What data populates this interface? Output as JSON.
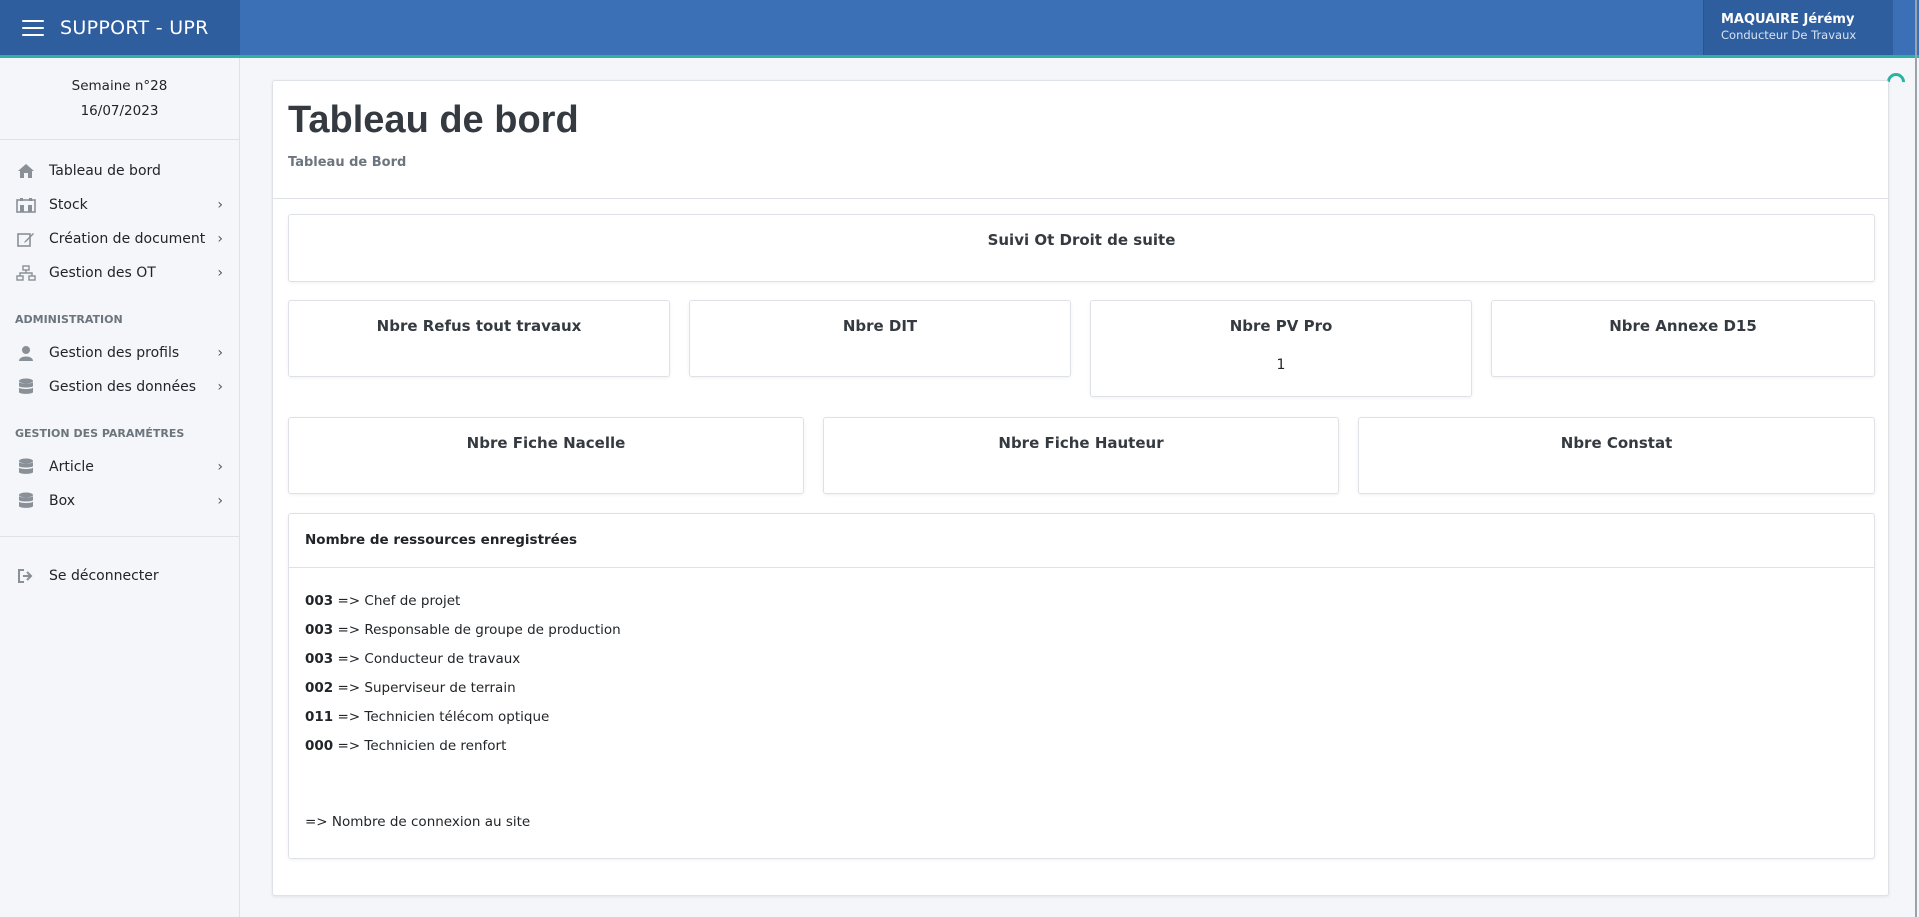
{
  "app": {
    "title": "SUPPORT - UPR"
  },
  "user": {
    "name": "MAQUAIRE Jérémy",
    "role": "Conducteur De Travaux"
  },
  "sidebar": {
    "week_label": "Semaine n°28",
    "date": "16/07/2023",
    "items": [
      {
        "label": "Tableau de bord",
        "icon": "home-icon",
        "has_children": false
      },
      {
        "label": "Stock",
        "icon": "warehouse-icon",
        "has_children": true
      },
      {
        "label": "Création de document",
        "icon": "edit-icon",
        "has_children": true
      },
      {
        "label": "Gestion des OT",
        "icon": "sitemap-icon",
        "has_children": true
      }
    ],
    "admin_title": "ADMINISTRATION",
    "admin_items": [
      {
        "label": "Gestion des profils",
        "icon": "user-icon"
      },
      {
        "label": "Gestion des données",
        "icon": "database-icon"
      }
    ],
    "params_title": "GESTION DES PARAMÉTRES",
    "params_items": [
      {
        "label": "Article",
        "icon": "database-icon"
      },
      {
        "label": "Box",
        "icon": "database-icon"
      }
    ],
    "logout_label": "Se déconnecter"
  },
  "page": {
    "title": "Tableau de bord",
    "breadcrumb": "Tableau de Bord",
    "banner": "Suivi Ot Droit de suite",
    "stats_row1": [
      {
        "title": "Nbre Refus tout travaux",
        "value": ""
      },
      {
        "title": "Nbre DIT",
        "value": ""
      },
      {
        "title": "Nbre PV Pro",
        "value": "1"
      },
      {
        "title": "Nbre Annexe D15",
        "value": ""
      }
    ],
    "stats_row2": [
      {
        "title": "Nbre Fiche Nacelle",
        "value": ""
      },
      {
        "title": "Nbre Fiche Hauteur",
        "value": ""
      },
      {
        "title": "Nbre Constat",
        "value": ""
      }
    ],
    "resources": {
      "title": "Nombre de ressources enregistrées",
      "rows": [
        {
          "count": "003",
          "text": " => Chef de projet"
        },
        {
          "count": "003",
          "text": " => Responsable de groupe de production"
        },
        {
          "count": "003",
          "text": " => Conducteur de travaux"
        },
        {
          "count": "002",
          "text": " => Superviseur de terrain"
        },
        {
          "count": "011",
          "text": " => Technicien télécom optique"
        },
        {
          "count": "000",
          "text": " => Technicien de renfort"
        }
      ],
      "footer": "=> Nombre de connexion au site"
    }
  },
  "colors": {
    "topbar": "#3b6fb6",
    "brand_bg": "#2f5e9f",
    "accent": "#2bb3a0"
  }
}
